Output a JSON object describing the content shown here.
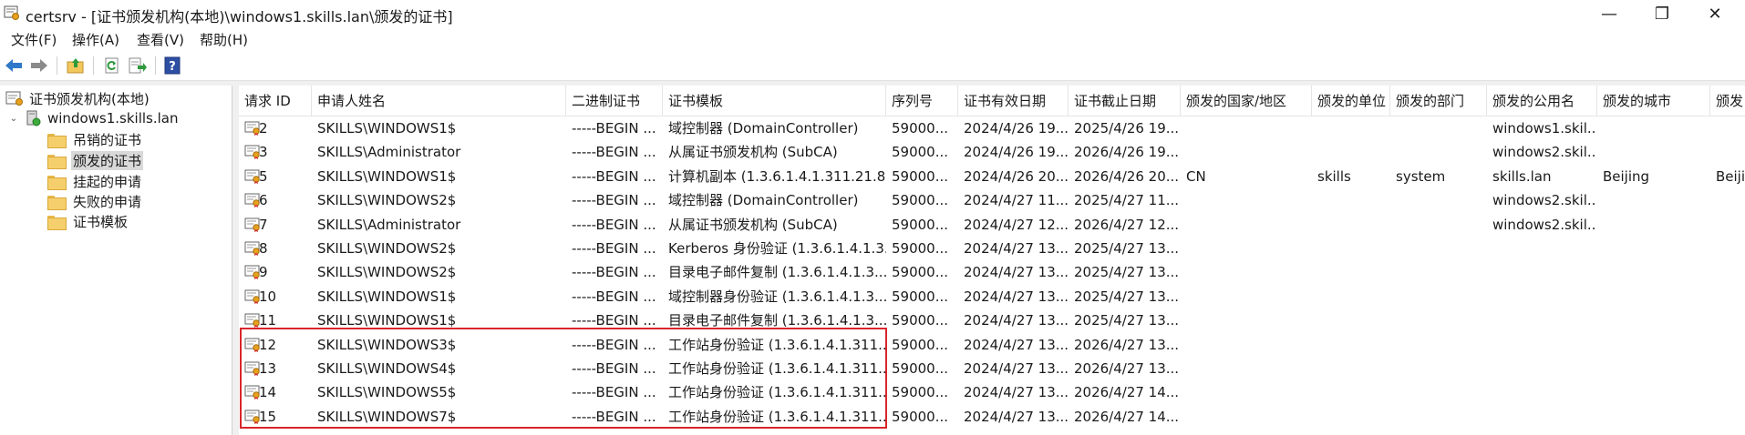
{
  "window": {
    "title": "certsrv - [证书颁发机构(本地)\\windows1.skills.lan\\颁发的证书]",
    "minimize_glyph": "—",
    "restore_glyph": "❐",
    "close_glyph": "✕"
  },
  "menu": [
    "文件(F)",
    "操作(A)",
    "查看(V)",
    "帮助(H)"
  ],
  "toolbar": {
    "icons": [
      "back-arrow-icon",
      "forward-arrow-icon",
      "up-folder-icon",
      "refresh-icon",
      "export-list-icon",
      "help-icon"
    ]
  },
  "tree": {
    "root": "证书颁发机构(本地)",
    "server": "windows1.skills.lan",
    "folders": [
      "吊销的证书",
      "颁发的证书",
      "挂起的申请",
      "失败的申请",
      "证书模板"
    ],
    "selected": "颁发的证书"
  },
  "columns": [
    "请求 ID",
    "申请人姓名",
    "二进制证书",
    "证书模板",
    "序列号",
    "证书有效日期",
    "证书截止日期",
    "颁发的国家/地区",
    "颁发的单位",
    "颁发的部门",
    "颁发的公用名",
    "颁发的城市",
    "颁发"
  ],
  "rows": [
    [
      "2",
      "SKILLS\\WINDOWS1$",
      "-----BEGIN ...",
      "域控制器 (DomainController)",
      "59000...",
      "2024/4/26 19...",
      "2025/4/26 19...",
      "",
      "",
      "",
      "windows1.skil...",
      "",
      ""
    ],
    [
      "3",
      "SKILLS\\Administrator",
      "-----BEGIN ...",
      "从属证书颁发机构 (SubCA)",
      "59000...",
      "2024/4/26 19...",
      "2026/4/26 19...",
      "",
      "",
      "",
      "windows2.skil...",
      "",
      ""
    ],
    [
      "5",
      "SKILLS\\WINDOWS1$",
      "-----BEGIN ...",
      "计算机副本 (1.3.6.1.4.1.311.21.8...",
      "59000...",
      "2024/4/26 20...",
      "2026/4/26 20...",
      "CN",
      "skills",
      "system",
      "skills.lan",
      "Beijing",
      "Beiji"
    ],
    [
      "6",
      "SKILLS\\WINDOWS2$",
      "-----BEGIN ...",
      "域控制器 (DomainController)",
      "59000...",
      "2024/4/27 11...",
      "2025/4/27 11...",
      "",
      "",
      "",
      "windows2.skil...",
      "",
      ""
    ],
    [
      "7",
      "SKILLS\\Administrator",
      "-----BEGIN ...",
      "从属证书颁发机构 (SubCA)",
      "59000...",
      "2024/4/27 12...",
      "2026/4/27 12...",
      "",
      "",
      "",
      "windows2.skil...",
      "",
      ""
    ],
    [
      "8",
      "SKILLS\\WINDOWS2$",
      "-----BEGIN ...",
      "Kerberos 身份验证 (1.3.6.1.4.1.3...",
      "59000...",
      "2024/4/27 13...",
      "2025/4/27 13...",
      "",
      "",
      "",
      "",
      "",
      ""
    ],
    [
      "9",
      "SKILLS\\WINDOWS2$",
      "-----BEGIN ...",
      "目录电子邮件复制 (1.3.6.1.4.1.3...",
      "59000...",
      "2024/4/27 13...",
      "2025/4/27 13...",
      "",
      "",
      "",
      "",
      "",
      ""
    ],
    [
      "10",
      "SKILLS\\WINDOWS1$",
      "-----BEGIN ...",
      "域控制器身份验证 (1.3.6.1.4.1.3...",
      "59000...",
      "2024/4/27 13...",
      "2025/4/27 13...",
      "",
      "",
      "",
      "",
      "",
      ""
    ],
    [
      "11",
      "SKILLS\\WINDOWS1$",
      "-----BEGIN ...",
      "目录电子邮件复制 (1.3.6.1.4.1.3...",
      "59000...",
      "2024/4/27 13...",
      "2025/4/27 13...",
      "",
      "",
      "",
      "",
      "",
      ""
    ],
    [
      "12",
      "SKILLS\\WINDOWS3$",
      "-----BEGIN ...",
      "工作站身份验证 (1.3.6.1.4.1.311....",
      "59000...",
      "2024/4/27 13...",
      "2026/4/27 13...",
      "",
      "",
      "",
      "",
      "",
      ""
    ],
    [
      "13",
      "SKILLS\\WINDOWS4$",
      "-----BEGIN ...",
      "工作站身份验证 (1.3.6.1.4.1.311....",
      "59000...",
      "2024/4/27 13...",
      "2026/4/27 13...",
      "",
      "",
      "",
      "",
      "",
      ""
    ],
    [
      "14",
      "SKILLS\\WINDOWS5$",
      "-----BEGIN ...",
      "工作站身份验证 (1.3.6.1.4.1.311....",
      "59000...",
      "2024/4/27 13...",
      "2026/4/27 14...",
      "",
      "",
      "",
      "",
      "",
      ""
    ],
    [
      "15",
      "SKILLS\\WINDOWS7$",
      "-----BEGIN ...",
      "工作站身份验证 (1.3.6.1.4.1.311....",
      "59000...",
      "2024/4/27 13...",
      "2026/4/27 14...",
      "",
      "",
      "",
      "",
      "",
      ""
    ]
  ],
  "highlight_color": "#d9262b"
}
